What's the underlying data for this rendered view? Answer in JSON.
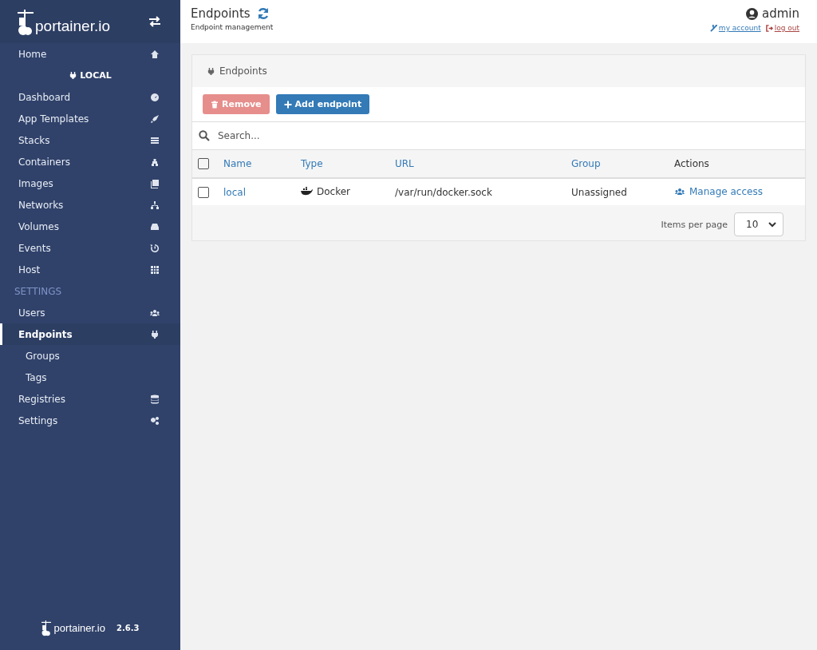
{
  "sidebar": {
    "brand": "portainer.io",
    "items": [
      {
        "kind": "item",
        "label": "Home",
        "selected": false
      },
      {
        "kind": "endpoint",
        "label": "LOCAL"
      },
      {
        "kind": "item",
        "label": "Dashboard",
        "selected": false
      },
      {
        "kind": "item",
        "label": "App Templates",
        "selected": false
      },
      {
        "kind": "item",
        "label": "Stacks",
        "selected": false
      },
      {
        "kind": "item",
        "label": "Containers",
        "selected": false
      },
      {
        "kind": "item",
        "label": "Images",
        "selected": false
      },
      {
        "kind": "item",
        "label": "Networks",
        "selected": false
      },
      {
        "kind": "item",
        "label": "Volumes",
        "selected": false
      },
      {
        "kind": "item",
        "label": "Events",
        "selected": false
      },
      {
        "kind": "item",
        "label": "Host",
        "selected": false
      },
      {
        "kind": "section",
        "label": "SETTINGS"
      },
      {
        "kind": "item",
        "label": "Users",
        "selected": false
      },
      {
        "kind": "item",
        "label": "Endpoints",
        "selected": true
      },
      {
        "kind": "subitem",
        "label": "Groups",
        "selected": false
      },
      {
        "kind": "subitem",
        "label": "Tags",
        "selected": false
      },
      {
        "kind": "item",
        "label": "Registries",
        "selected": false
      },
      {
        "kind": "item",
        "label": "Settings",
        "selected": false
      }
    ],
    "footer": {
      "brand": "portainer.io",
      "version": "2.6.3"
    }
  },
  "header": {
    "title": "Endpoints",
    "subtitle": "Endpoint management",
    "user": "admin",
    "links": [
      {
        "kind": "account",
        "label": "my account"
      },
      {
        "kind": "logout",
        "label": "log out"
      }
    ]
  },
  "panel": {
    "title": "Endpoints",
    "buttons": [
      {
        "kind": "remove",
        "label": "Remove",
        "disabled": true
      },
      {
        "kind": "add",
        "label": "Add endpoint",
        "disabled": false
      }
    ],
    "search": {
      "placeholder": "Search..."
    },
    "columns": [
      {
        "label": "Name",
        "sortable": true
      },
      {
        "label": "Type",
        "sortable": true
      },
      {
        "label": "URL",
        "sortable": true
      },
      {
        "label": "Group",
        "sortable": true
      },
      {
        "label": "Actions",
        "sortable": false
      }
    ],
    "select_all": {
      "checked": false
    },
    "rows": [
      {
        "checked": false,
        "name": "local",
        "type": "Docker",
        "url": "/var/run/docker.sock",
        "group": "Unassigned",
        "action": "Manage access"
      }
    ],
    "pagination": {
      "label": "Items per page",
      "value": "10"
    }
  }
}
